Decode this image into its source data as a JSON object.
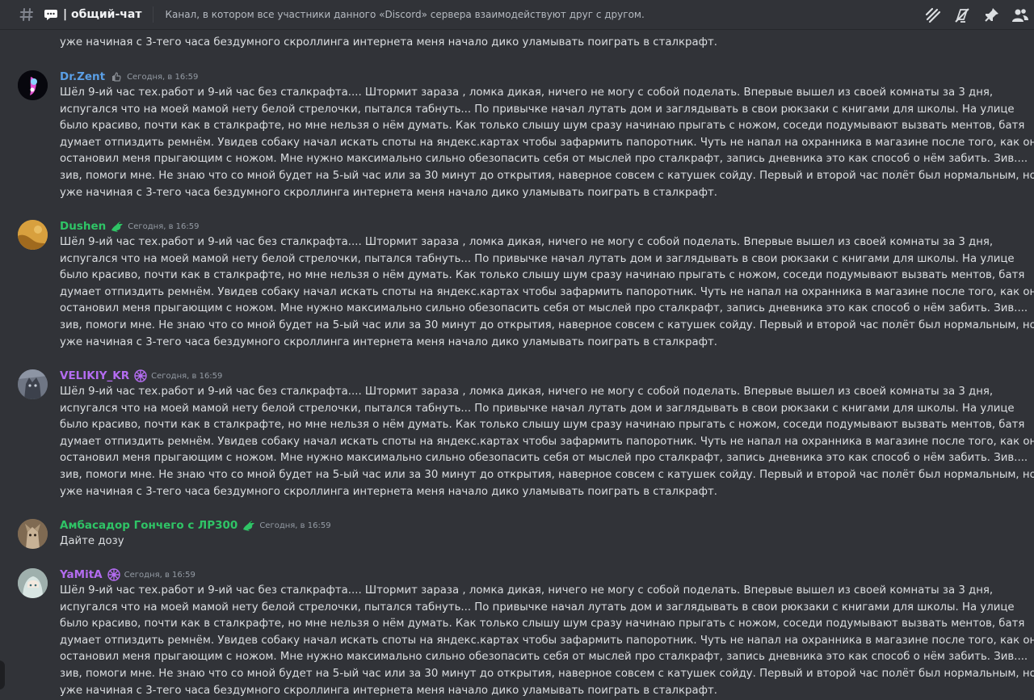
{
  "header": {
    "channel_name": "| общий-чат",
    "topic": "Канал, в котором все участники данного «Discord» сервера взаимодействуют друг с другом.",
    "icons": [
      "threads-icon",
      "mute-icon",
      "pin-icon",
      "members-icon"
    ]
  },
  "messages": [
    {
      "lines": [
        "уже начиная с 3-тего часа бездумного скроллинга интернета меня начало дико уламывать поиграть в сталкрафт."
      ]
    },
    {
      "author": "Dr.Zent",
      "author_color": "#5a9fe6",
      "timestamp": "Сегодня, в 16:59",
      "badge": "thumb-badge-icon",
      "lines": [
        "Шёл 9-ий час тех.работ и 9-ий час без сталкрафта.... Штормит зараза , ломка дикая, ничего не могу с собой поделать. Впервые вышел из своей комнаты за 3 дня,",
        "испугался что на моей мамой нету белой стрелочки, пытался табнуть... По привычке начал лутать дом и заглядывать в свои рюкзаки с книгами для школы. На улице",
        "было красиво, почти как в сталкрафте, но мне нельзя о нём думать. Как только слышу шум сразу начинаю прыгать с ножом, соседи подумывают вызвать ментов, батя",
        "думает отпиздить ремнём. Увидев собаку начал искать споты на яндекс.картах чтобы зафармить папоротник. Чуть не напал на охранника в магазине после того, как он",
        "остановил меня прыгающим с ножом. Мне нужно максимально сильно обезопасить себя от мыслей про сталкрафт, запись дневника это как способ о нём забить. Зив....",
        "зив, помоги мне. Не знаю что со мной будет на 5-ый час или за 30 минут до открытия, наверное совсем с катушек сойду. Первый и второй час полёт был нормальным, но",
        "уже начиная с 3-тего часа бездумного скроллинга интернета меня начало дико уламывать поиграть в сталкрафт."
      ]
    },
    {
      "author": "Dushen",
      "author_color": "#2fc466",
      "timestamp": "Сегодня, в 16:59",
      "badge": "dragon-badge-icon",
      "lines": [
        "Шёл 9-ий час тех.работ и 9-ий час без сталкрафта.... Штормит зараза , ломка дикая, ничего не могу с собой поделать. Впервые вышел из своей комнаты за 3 дня,",
        "испугался что на моей мамой нету белой стрелочки, пытался табнуть... По привычке начал лутать дом и заглядывать в свои рюкзаки с книгами для школы. На улице",
        "было красиво, почти как в сталкрафте, но мне нельзя о нём думать. Как только слышу шум сразу начинаю прыгать с ножом, соседи подумывают вызвать ментов, батя",
        "думает отпиздить ремнём. Увидев собаку начал искать споты на яндекс.картах чтобы зафармить папоротник. Чуть не напал на охранника в магазине после того, как он",
        "остановил меня прыгающим с ножом. Мне нужно максимально сильно обезопасить себя от мыслей про сталкрафт, запись дневника это как способ о нём забить. Зив....",
        "зив, помоги мне. Не знаю что со мной будет на 5-ый час или за 30 минут до открытия, наверное совсем с катушек сойду. Первый и второй час полёт был нормальным, но",
        "уже начиная с 3-тего часа бездумного скроллинга интернета меня начало дико уламывать поиграть в сталкрафт."
      ]
    },
    {
      "author": "VELIKIY_KR",
      "author_color": "#b36cf0",
      "timestamp": "Сегодня, в 16:59",
      "badge": "flower-badge-icon",
      "lines": [
        "Шёл 9-ий час тех.работ и 9-ий час без сталкрафта.... Штормит зараза , ломка дикая, ничего не могу с собой поделать. Впервые вышел из своей комнаты за 3 дня,",
        "испугался что на моей мамой нету белой стрелочки, пытался табнуть... По привычке начал лутать дом и заглядывать в свои рюкзаки с книгами для школы. На улице",
        "было красиво, почти как в сталкрафте, но мне нельзя о нём думать. Как только слышу шум сразу начинаю прыгать с ножом, соседи подумывают вызвать ментов, батя",
        "думает отпиздить ремнём. Увидев собаку начал искать споты на яндекс.картах чтобы зафармить папоротник. Чуть не напал на охранника в магазине после того, как он",
        "остановил меня прыгающим с ножом. Мне нужно максимально сильно обезопасить себя от мыслей про сталкрафт, запись дневника это как способ о нём забить. Зив....",
        "зив, помоги мне. Не знаю что со мной будет на 5-ый час или за 30 минут до открытия, наверное совсем с катушек сойду. Первый и второй час полёт был нормальным, но",
        "уже начиная с 3-тего часа бездумного скроллинга интернета меня начало дико уламывать поиграть в сталкрафт."
      ]
    },
    {
      "author": "Амбасадор Гончего с ЛР300",
      "author_color": "#2fc466",
      "timestamp": "Сегодня, в 16:59",
      "badge": "dragon-badge-icon",
      "lines": [
        "Дайте дозу"
      ]
    },
    {
      "author": "YaMitA",
      "author_color": "#b36cf0",
      "timestamp": "Сегодня, в 16:59",
      "badge": "flower-badge-icon",
      "lines": [
        "Шёл 9-ий час тех.работ и 9-ий час без сталкрафта.... Штормит зараза , ломка дикая, ничего не могу с собой поделать. Впервые вышел из своей комнаты за 3 дня,",
        "испугался что на моей мамой нету белой стрелочки, пытался табнуть... По привычке начал лутать дом и заглядывать в свои рюкзаки с книгами для школы. На улице",
        "было красиво, почти как в сталкрафте, но мне нельзя о нём думать. Как только слышу шум сразу начинаю прыгать с ножом, соседи подумывают вызвать ментов, батя",
        "думает отпиздить ремнём. Увидев собаку начал искать споты на яндекс.картах чтобы зафармить папоротник. Чуть не напал на охранника в магазине после того, как он",
        "остановил меня прыгающим с ножом. Мне нужно максимально сильно обезопасить себя от мыслей про сталкрафт, запись дневника это как способ о нём забить. Зив....",
        "зив, помоги мне. Не знаю что со мной будет на 5-ый час или за 30 минут до открытия, наверное совсем с катушек сойду. Первый и второй час полёт был нормальным, но",
        "уже начиная с 3-тего часа бездумного скроллинга интернета меня начало дико уламывать поиграть в сталкрафт."
      ]
    }
  ]
}
